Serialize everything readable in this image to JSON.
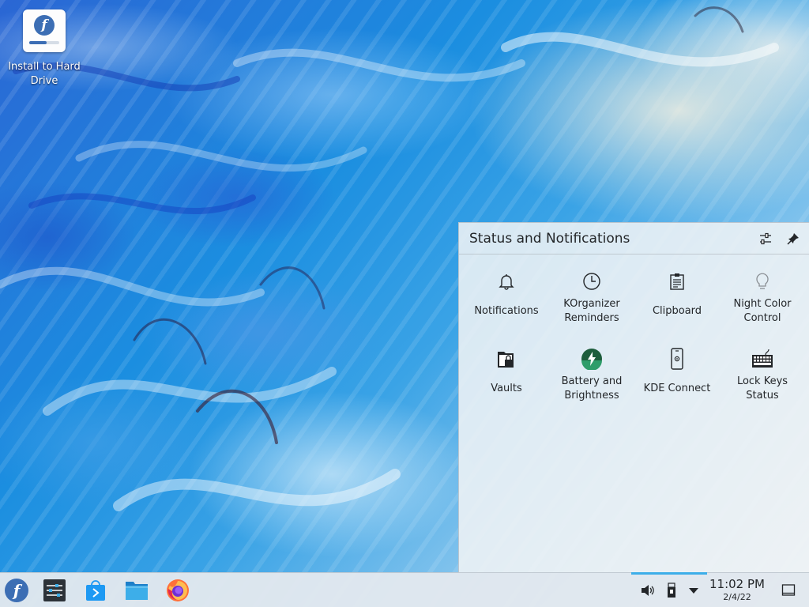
{
  "desktop": {
    "icons": [
      {
        "label": "Install to Hard Drive",
        "icon": "fedora-install-icon"
      }
    ]
  },
  "popup": {
    "title": "Status and Notifications",
    "header_buttons": [
      {
        "name": "configure-icon"
      },
      {
        "name": "pin-icon"
      }
    ],
    "applets": [
      {
        "label": "Notifications",
        "icon": "bell-icon"
      },
      {
        "label": "KOrganizer Reminders",
        "icon": "clock-icon"
      },
      {
        "label": "Clipboard",
        "icon": "clipboard-icon"
      },
      {
        "label": "Night Color Control",
        "icon": "lightbulb-icon"
      },
      {
        "label": "Vaults",
        "icon": "vault-icon"
      },
      {
        "label": "Battery and Brightness",
        "icon": "battery-icon"
      },
      {
        "label": "KDE Connect",
        "icon": "phone-icon"
      },
      {
        "label": "Lock Keys Status",
        "icon": "keyboard-icon"
      }
    ]
  },
  "taskbar": {
    "launchers": [
      {
        "name": "fedora-menu-icon"
      },
      {
        "name": "system-settings-icon"
      },
      {
        "name": "discover-icon"
      },
      {
        "name": "file-manager-icon"
      },
      {
        "name": "firefox-icon"
      }
    ],
    "tray": [
      {
        "name": "volume-icon"
      },
      {
        "name": "usb-device-icon"
      },
      {
        "name": "tray-expand-icon"
      }
    ],
    "clock": {
      "time": "11:02 PM",
      "date": "2/4/22"
    }
  },
  "colors": {
    "accent": "#3daee9",
    "fedora_blue": "#3c6eb4",
    "text": "#232629"
  }
}
